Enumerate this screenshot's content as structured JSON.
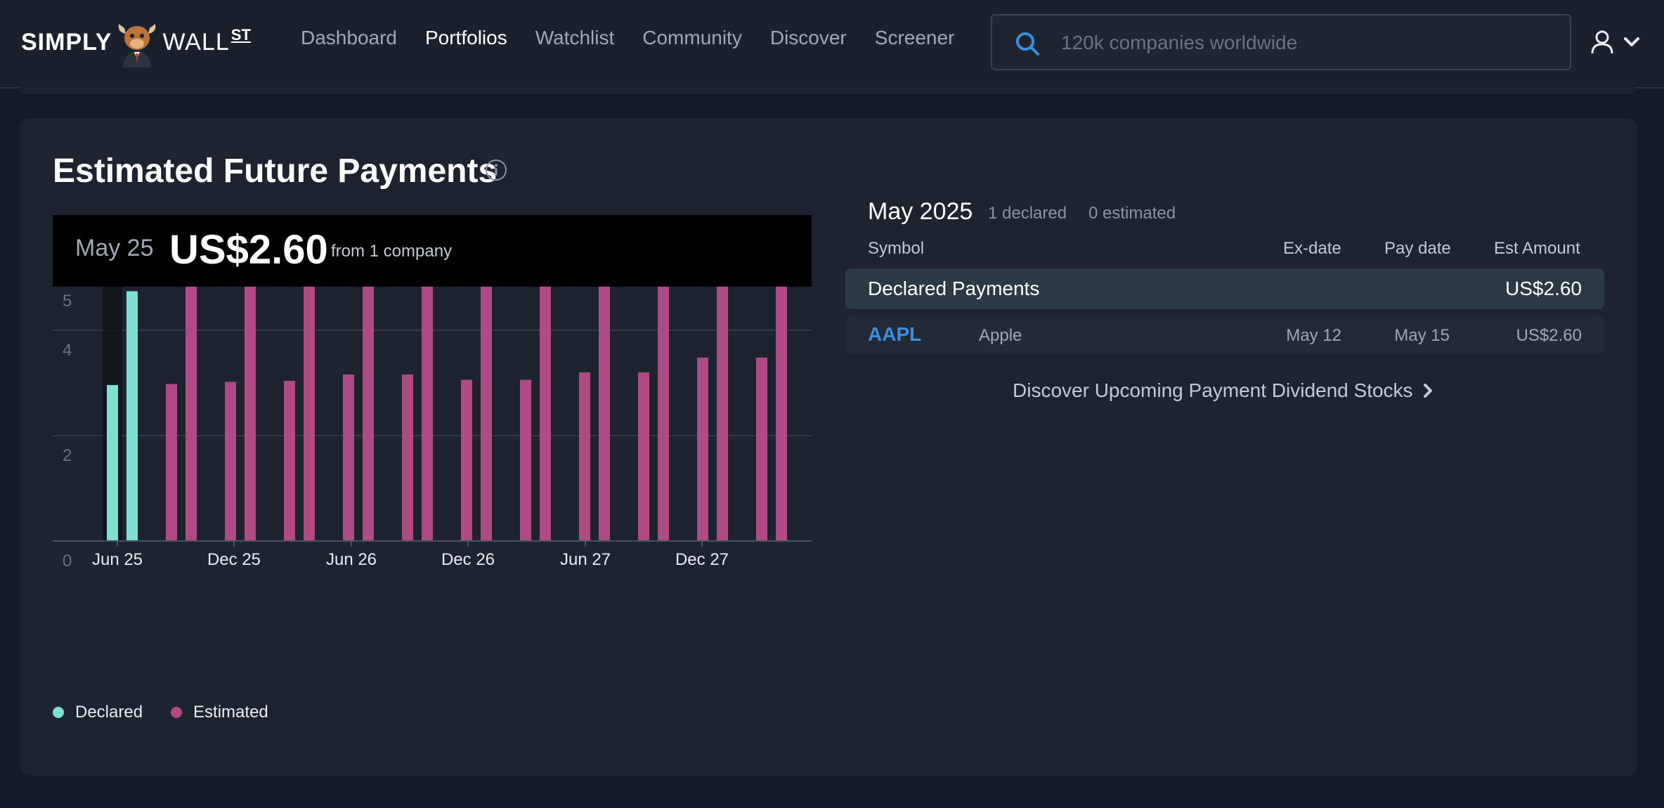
{
  "brand": {
    "name_left": "SIMPLY",
    "name_right": "WALL",
    "name_suffix": "ST"
  },
  "nav": {
    "items": [
      {
        "label": "Dashboard",
        "active": false
      },
      {
        "label": "Portfolios",
        "active": true
      },
      {
        "label": "Watchlist",
        "active": false
      },
      {
        "label": "Community",
        "active": false
      },
      {
        "label": "Discover",
        "active": false
      },
      {
        "label": "Screener",
        "active": false
      }
    ]
  },
  "search": {
    "placeholder": "120k companies worldwide",
    "value": ""
  },
  "card": {
    "title": "Estimated Future Payments",
    "tooltip": {
      "date": "May 25",
      "amount": "US$2.60",
      "from": "from 1 company"
    }
  },
  "legend": {
    "declared": "Declared",
    "estimated": "Estimated"
  },
  "colors": {
    "declared": "#7ee0d2",
    "estimated": "#b04a84",
    "accent_link": "#3b8fe0"
  },
  "chart_data": {
    "type": "bar",
    "ylim": [
      0,
      5.3
    ],
    "y_ticks": [
      "0",
      "2",
      "4",
      "5"
    ],
    "y_tick_values": [
      0,
      2,
      4,
      5
    ],
    "x_tick_labels": [
      "Jun 25",
      "Dec 25",
      "Jun 26",
      "Dec 26",
      "Jun 27",
      "Dec 27"
    ],
    "x_tick_months": [
      1,
      7,
      13,
      19,
      25,
      31
    ],
    "highlighted_month": 0,
    "series": [
      {
        "name": "Declared",
        "status": "declared",
        "points": [
          {
            "month": 0,
            "value": 2.96
          },
          {
            "month": 1,
            "value": 4.74
          }
        ]
      },
      {
        "name": "Estimated",
        "status": "estimated",
        "points": [
          {
            "month": 3,
            "value": 2.98
          },
          {
            "month": 4,
            "value": 5.2
          },
          {
            "month": 6,
            "value": 3.02
          },
          {
            "month": 7,
            "value": 5.2
          },
          {
            "month": 9,
            "value": 3.04
          },
          {
            "month": 10,
            "value": 5.2
          },
          {
            "month": 12,
            "value": 3.16
          },
          {
            "month": 13,
            "value": 5.14
          },
          {
            "month": 15,
            "value": 3.16
          },
          {
            "month": 16,
            "value": 5.64
          },
          {
            "month": 18,
            "value": 3.06
          },
          {
            "month": 19,
            "value": 5.64
          },
          {
            "month": 21,
            "value": 3.06
          },
          {
            "month": 22,
            "value": 5.64
          },
          {
            "month": 24,
            "value": 3.2
          },
          {
            "month": 25,
            "value": 5.64
          },
          {
            "month": 27,
            "value": 3.2
          },
          {
            "month": 28,
            "value": 6.0
          },
          {
            "month": 30,
            "value": 3.48
          },
          {
            "month": 31,
            "value": 6.0
          },
          {
            "month": 33,
            "value": 3.48
          },
          {
            "month": 34,
            "value": 6.0
          }
        ]
      }
    ]
  },
  "panel": {
    "month": "May 2025",
    "declared_count": "1 declared",
    "estimated_count": "0 estimated",
    "headers": {
      "symbol": "Symbol",
      "ex_date": "Ex-date",
      "pay_date": "Pay date",
      "est_amount": "Est Amount"
    },
    "declared_row": {
      "label": "Declared Payments",
      "amount": "US$2.60"
    },
    "rows": [
      {
        "symbol": "AAPL",
        "name": "Apple",
        "ex_date": "May 12",
        "pay_date": "May 15",
        "amount": "US$2.60"
      }
    ],
    "discover_link": "Discover Upcoming Payment Dividend Stocks"
  }
}
